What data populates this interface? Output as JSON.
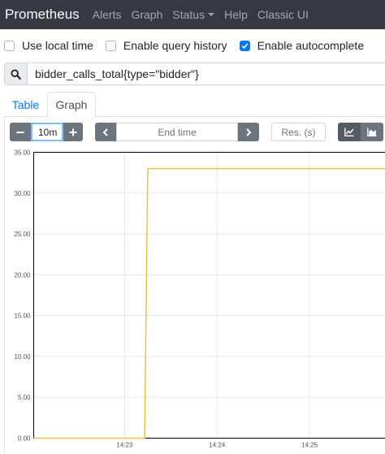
{
  "navbar": {
    "brand": "Prometheus",
    "items": [
      {
        "label": "Alerts"
      },
      {
        "label": "Graph"
      },
      {
        "label": "Status"
      },
      {
        "label": "Help"
      },
      {
        "label": "Classic UI"
      }
    ]
  },
  "options": {
    "local_time": {
      "label": "Use local time",
      "checked": false
    },
    "query_history": {
      "label": "Enable query history",
      "checked": false
    },
    "autocomplete": {
      "label": "Enable autocomplete",
      "checked": true
    }
  },
  "query": {
    "value": "bidder_calls_total{type=\"bidder\"}"
  },
  "tabs": [
    {
      "label": "Table",
      "active": false
    },
    {
      "label": "Graph",
      "active": true
    }
  ],
  "controls": {
    "range_value": "10m",
    "end_time_placeholder": "End time",
    "resolution_placeholder": "Res. (s)"
  },
  "colors": {
    "navbar": "#343a40",
    "accent": "#007bff",
    "series": "#edc240"
  },
  "chart_data": {
    "type": "line",
    "y_ticks": [
      "0.00",
      "5.00",
      "10.00",
      "15.00",
      "20.00",
      "25.00",
      "30.00",
      "35.00"
    ],
    "x_ticks": [
      {
        "label": "14:23",
        "value": 0
      },
      {
        "label": "14:24",
        "value": 60
      },
      {
        "label": "14:25",
        "value": 120
      }
    ],
    "ylim": [
      0,
      35
    ],
    "xlim": [
      -59,
      169
    ],
    "grid": true,
    "series": [
      {
        "x": [
          -59,
          13,
          15,
          169
        ],
        "y": [
          0,
          0,
          33,
          33
        ]
      }
    ]
  }
}
